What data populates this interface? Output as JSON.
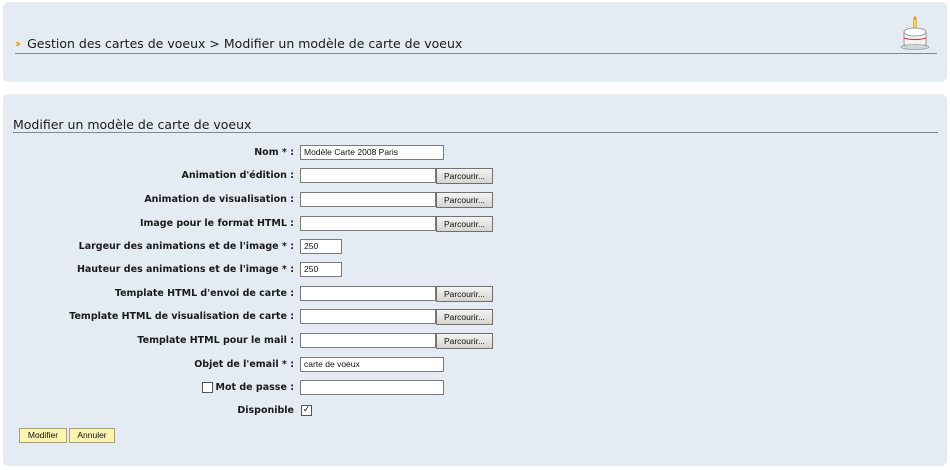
{
  "header": {
    "breadcrumb": {
      "section": "Gestion des cartes de voeux",
      "separator": ">",
      "current": "Modifier un modèle de carte de voeux"
    },
    "icon": "cake-icon"
  },
  "form": {
    "title": "Modifier un modèle de carte de voeux",
    "fields": {
      "nom": {
        "label": "Nom * :",
        "value": "Modèle Carte 2008 Paris"
      },
      "animation_edition": {
        "label": "Animation d'édition :",
        "value": ""
      },
      "animation_visualisation": {
        "label": "Animation de visualisation :",
        "value": ""
      },
      "image_html": {
        "label": "Image pour le format HTML :",
        "value": ""
      },
      "largeur": {
        "label": "Largeur des animations et de l'image * :",
        "value": "250"
      },
      "hauteur": {
        "label": "Hauteur des animations et de l'image * :",
        "value": "250"
      },
      "template_envoi": {
        "label": "Template HTML d'envoi de carte :",
        "value": ""
      },
      "template_visualisation": {
        "label": "Template HTML de visualisation de carte :",
        "value": ""
      },
      "template_mail": {
        "label": "Template HTML pour le mail :",
        "value": ""
      },
      "objet_email": {
        "label": "Objet de l'email * :",
        "value": "carte de voeux"
      },
      "mot_de_passe": {
        "label": "Mot de passe :",
        "value": "",
        "checked": false
      },
      "disponible": {
        "label": "Disponible",
        "checked": true,
        "check_mark": "✓"
      }
    },
    "browse_label": "Parcourir...",
    "buttons": {
      "submit": "Modifier",
      "cancel": "Annuler"
    }
  },
  "colors": {
    "panel_bg": "#e4ebf3",
    "rule": "#7f8791",
    "button_bg": "#fbf5b0",
    "breadcrumb_arrow": "#e8a317"
  }
}
